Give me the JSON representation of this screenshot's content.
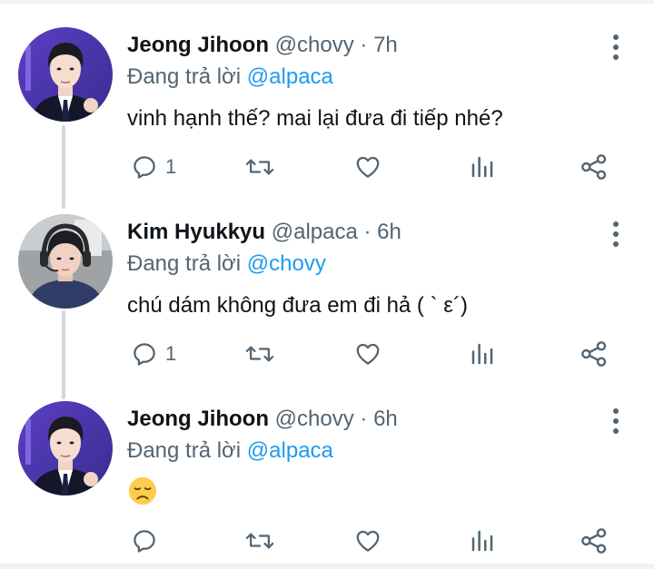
{
  "tweets": [
    {
      "name": "Jeong Jihoon",
      "handle": "@chovy",
      "time": "7h",
      "replying_prefix": "Đang trả lời",
      "replying_to": "@alpaca",
      "text": "vinh hạnh thế? mai lại đưa đi tiếp nhé?",
      "reply_count": "1",
      "avatar": "avatar-chovy"
    },
    {
      "name": "Kim Hyukkyu",
      "handle": "@alpaca",
      "time": "6h",
      "replying_prefix": "Đang trả lời",
      "replying_to": "@chovy",
      "text": "chú dám không đưa em đi hả ( ` ε´)",
      "reply_count": "1",
      "avatar": "avatar-alpaca"
    },
    {
      "name": "Jeong Jihoon",
      "handle": "@chovy",
      "time": "6h",
      "replying_prefix": "Đang trả lời",
      "replying_to": "@alpaca",
      "text": "",
      "emoji": "disappointed-face",
      "reply_count": "",
      "avatar": "avatar-chovy"
    }
  ],
  "separator": "·",
  "icons": [
    "reply-icon",
    "retweet-icon",
    "like-icon",
    "analytics-icon",
    "share-icon",
    "more-icon"
  ],
  "colors": {
    "text": "#0f1419",
    "muted": "#536471",
    "mention": "#1d9bf0",
    "line": "#cfd9de"
  }
}
